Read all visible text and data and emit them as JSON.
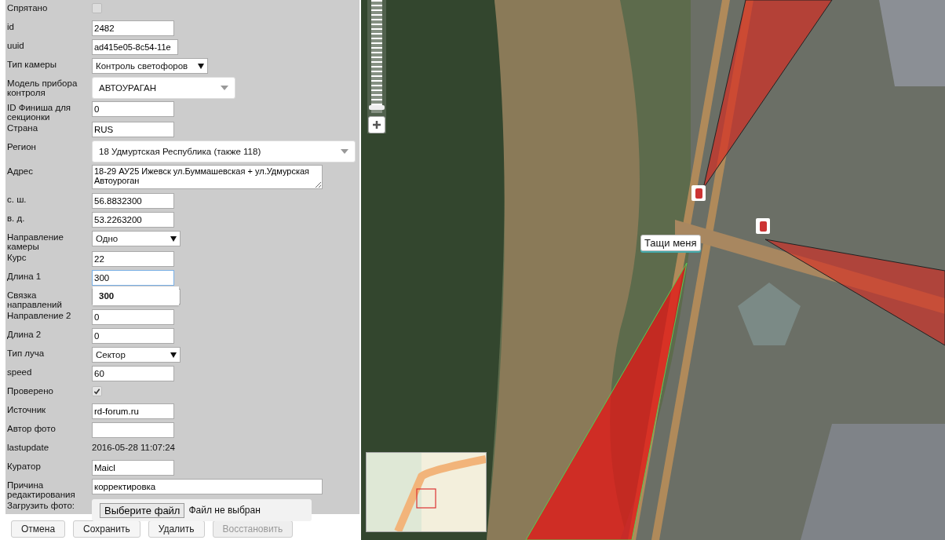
{
  "form": {
    "fields": [
      {
        "kind": "checkbox",
        "label": "Спрятано",
        "checked": false
      },
      {
        "kind": "text",
        "label": "id",
        "value": "2482"
      },
      {
        "kind": "text",
        "label": "uuid",
        "value": "ad415e05-8c54-11e"
      },
      {
        "kind": "select",
        "label": "Тип камеры",
        "value": "Контроль светофоров"
      },
      {
        "kind": "combo",
        "label": "Модель прибора контроля",
        "value": "АВТОУРАГАН"
      },
      {
        "kind": "text",
        "label": "ID Финиша для секционки",
        "value": "0"
      },
      {
        "kind": "text",
        "label": "Страна",
        "value": "RUS"
      },
      {
        "kind": "combo",
        "label": "Регион",
        "value": "18 Удмуртская Республика (также 118)"
      },
      {
        "kind": "textarea",
        "label": "Адрес",
        "value": "18-29 АУ25 Ижевск ул.Буммашевская + ул.Удмурская Автоуроган"
      },
      {
        "kind": "text",
        "label": "с. ш.",
        "value": "56.8832300"
      },
      {
        "kind": "text",
        "label": "в. д.",
        "value": "53.2263200"
      },
      {
        "kind": "select",
        "label": "Направление камеры",
        "value": "Одно"
      },
      {
        "kind": "text",
        "label": "Курс",
        "value": "22"
      },
      {
        "kind": "text",
        "label": "Длина 1",
        "value": "300",
        "focused": true,
        "suggestion": "300"
      },
      {
        "kind": "select",
        "label": "Связка направлений"
      },
      {
        "kind": "text",
        "label": "Направление 2",
        "value": "0"
      },
      {
        "kind": "text",
        "label": "Длина 2",
        "value": "0"
      },
      {
        "kind": "select",
        "label": "Тип луча",
        "value": "Сектор"
      },
      {
        "kind": "text",
        "label": "speed",
        "value": "60"
      },
      {
        "kind": "checkbox",
        "label": "Проверено",
        "checked": true
      },
      {
        "kind": "text",
        "label": "Источник",
        "value": "rd-forum.ru"
      },
      {
        "kind": "text",
        "label": "Автор фото"
      },
      {
        "kind": "static",
        "label": "lastupdate",
        "value": "2016-05-28 11:07:24"
      },
      {
        "kind": "text",
        "label": "Куратор",
        "value": "Maicl"
      },
      {
        "kind": "wide-text",
        "label": "Причина редактирования",
        "value": "корректировка"
      },
      {
        "kind": "file",
        "label": "Загрузить фото:",
        "button": "Выберите файл",
        "status": "Файл не выбран"
      }
    ]
  },
  "buttons": [
    {
      "label": "Отмена",
      "disabled": false
    },
    {
      "label": "Сохранить",
      "disabled": false
    },
    {
      "label": "Удалить",
      "disabled": false
    },
    {
      "label": "Восстановить",
      "disabled": true
    }
  ],
  "map": {
    "zoom_slider": {
      "level": 0.95
    },
    "drag_marker": {
      "label": "Тащи меня"
    }
  }
}
